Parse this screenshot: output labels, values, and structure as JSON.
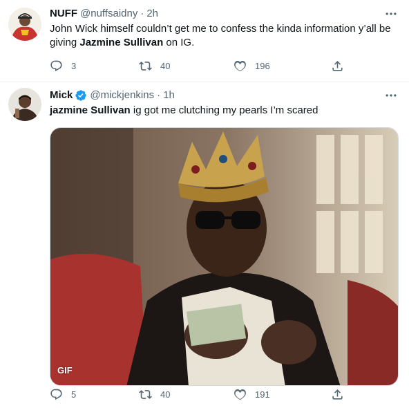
{
  "tweets": [
    {
      "name": "NUFF",
      "handle": "@nuffsaidny",
      "separator": "·",
      "time": "2h",
      "text_before": "John Wick himself couldn’t get me to confess the kinda information y’all be giving ",
      "text_bold": "Jazmine Sullivan",
      "text_after": " on IG.",
      "replies": "3",
      "retweets": "40",
      "likes": "196"
    },
    {
      "name": "Mick",
      "handle": "@mickjenkins",
      "separator": "·",
      "time": "1h",
      "verified": true,
      "text_bold": "jazmine Sullivan",
      "text_after": " ig got me clutching my pearls I’m scared",
      "media_badge": "GIF",
      "replies": "5",
      "retweets": "40",
      "likes": "191"
    }
  ],
  "colors": {
    "text": "#0f1419",
    "secondary": "#536471",
    "verified": "#1d9bf0",
    "divider": "#eff3f4"
  },
  "icons": [
    "reply-icon",
    "retweet-icon",
    "like-icon",
    "share-icon",
    "more-icon",
    "verified-icon"
  ]
}
